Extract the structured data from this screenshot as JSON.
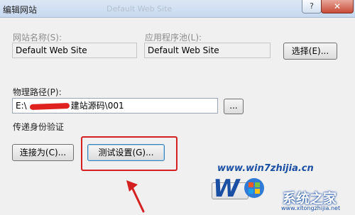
{
  "window": {
    "title": "编辑网站",
    "blurred_title": "Default Web Site",
    "help_label": "?",
    "close_label": "✕"
  },
  "site": {
    "name_label": "网站名称(S):",
    "name_value": "Default Web Site"
  },
  "app_pool": {
    "label": "应用程序池(L):",
    "value": "Default Web Site",
    "select_button": "选择(E)..."
  },
  "physical_path": {
    "label": "物理路径(P):",
    "value_prefix": "E:\\",
    "value_suffix": "建站源码\\001",
    "browse_button": "..."
  },
  "auth": {
    "label": "传递身份验证",
    "connect_as_button": "连接为(C)...",
    "test_settings_button": "测试设置(G)..."
  },
  "watermark": {
    "url": "www.win7zhijia.cn",
    "brand": "系统之家",
    "small": "www.xitongzhijia.net"
  },
  "colors": {
    "annotation": "#d42020",
    "watermark_blue": "#1a4fa3"
  }
}
